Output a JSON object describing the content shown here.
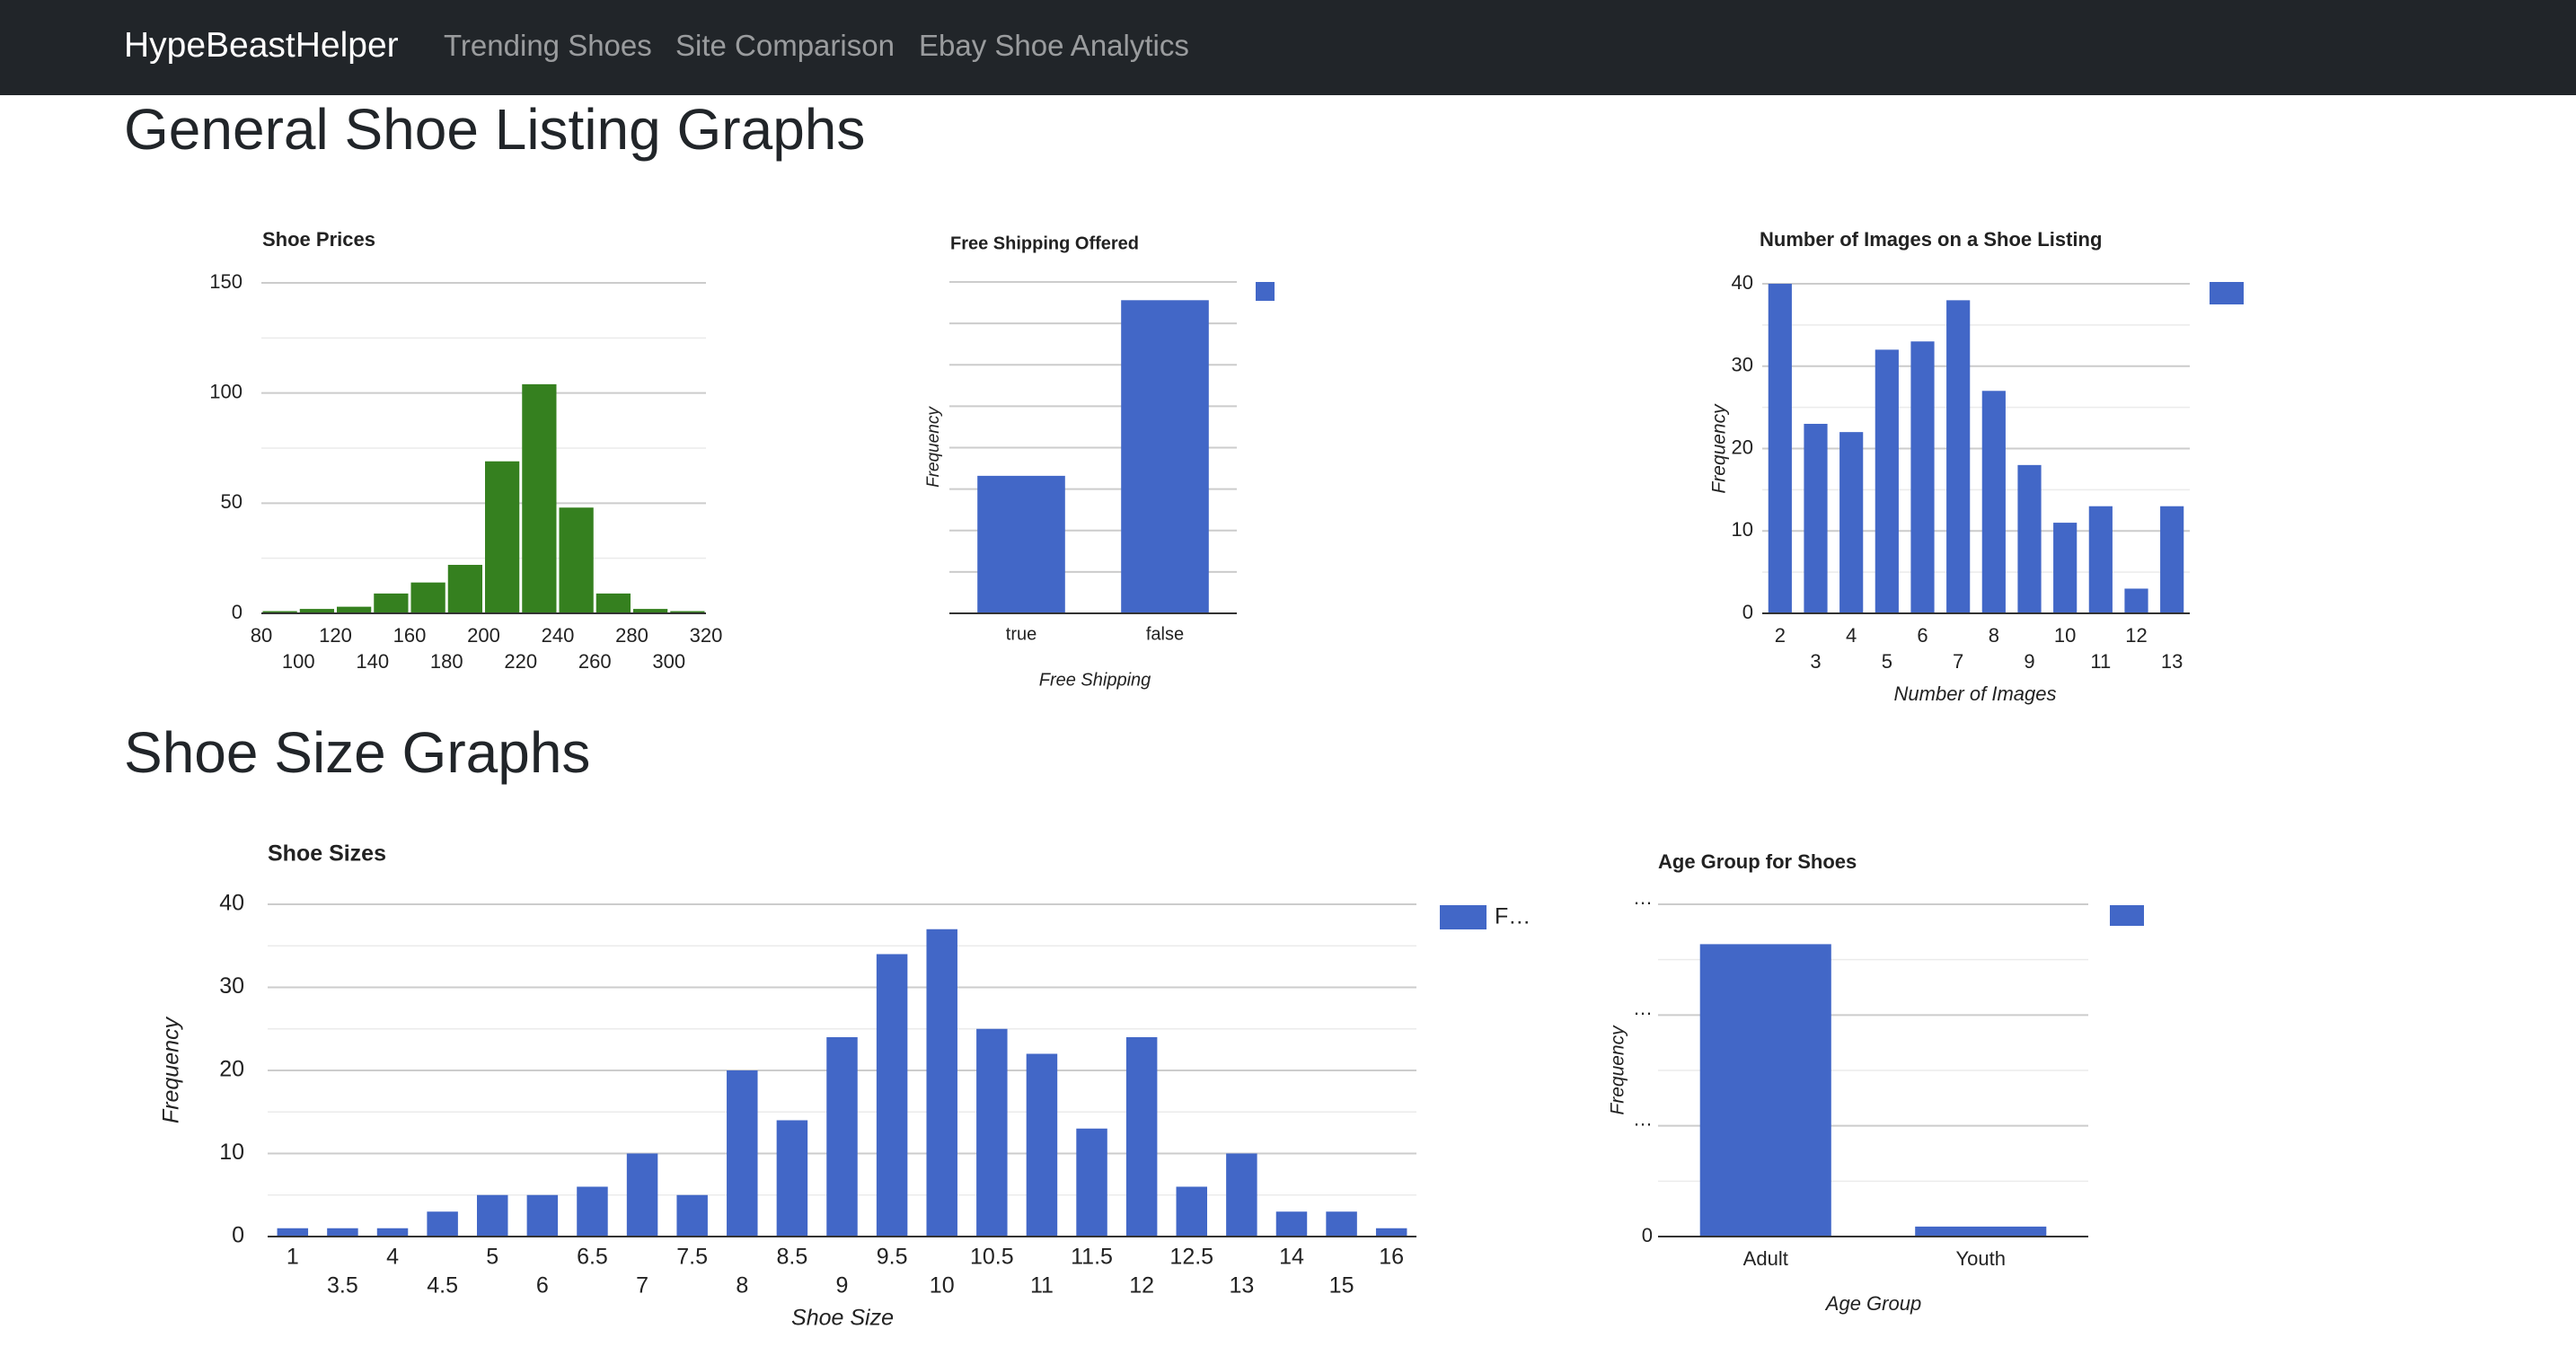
{
  "navbar": {
    "brand": "HypeBeastHelper",
    "links": [
      "Trending Shoes",
      "Site Comparison",
      "Ebay Shoe Analytics"
    ]
  },
  "sections": {
    "general_title": "General Shoe Listing Graphs",
    "size_title": "Shoe Size Graphs"
  },
  "colors": {
    "green": "#35801f",
    "blue": "#4267c7",
    "grid": "#cccccc",
    "minor_grid": "#ebebeb",
    "axis": "#333333"
  },
  "chart_data": [
    {
      "id": "prices",
      "type": "bar",
      "title": "Shoe Prices",
      "xlabel": "",
      "ylabel": "",
      "bin_edges": [
        80,
        100,
        120,
        140,
        160,
        180,
        200,
        220,
        240,
        260,
        280,
        300,
        320
      ],
      "values": [
        1,
        2,
        3,
        9,
        14,
        22,
        69,
        104,
        48,
        9,
        2,
        1
      ],
      "x_ticks_row1": [
        "80",
        "120",
        "160",
        "200",
        "240",
        "280",
        "320"
      ],
      "x_ticks_row2": [
        "100",
        "140",
        "180",
        "220",
        "260",
        "300"
      ],
      "y_ticks": [
        "0",
        "50",
        "100",
        "150"
      ],
      "ylim": [
        0,
        150
      ],
      "grid": true,
      "legend": "none"
    },
    {
      "id": "shipping",
      "type": "bar",
      "title": "Free Shipping Offered",
      "xlabel": "Free Shipping",
      "ylabel": "Frequency",
      "categories": [
        "true",
        "false"
      ],
      "values": [
        83,
        189
      ],
      "ylim": [
        0,
        200
      ],
      "grid": true,
      "legend": "top-right"
    },
    {
      "id": "images",
      "type": "bar",
      "title": "Number of Images on a Shoe Listing",
      "xlabel": "Number of Images",
      "ylabel": "Frequency",
      "categories": [
        "2",
        "3",
        "4",
        "5",
        "6",
        "7",
        "8",
        "9",
        "10",
        "11",
        "12",
        "13"
      ],
      "values": [
        40,
        23,
        22,
        32,
        33,
        38,
        27,
        18,
        11,
        13,
        3,
        13
      ],
      "y_ticks": [
        "0",
        "10",
        "20",
        "30",
        "40"
      ],
      "ylim": [
        0,
        40
      ],
      "grid": true,
      "legend": "top-right"
    },
    {
      "id": "sizes",
      "type": "bar",
      "title": "Shoe Sizes",
      "xlabel": "Shoe Size",
      "ylabel": "Frequency",
      "categories": [
        "1",
        "3.5",
        "4",
        "4.5",
        "5",
        "6",
        "6.5",
        "7",
        "7.5",
        "8",
        "8.5",
        "9",
        "9.5",
        "10",
        "10.5",
        "11",
        "11.5",
        "12",
        "12.5",
        "13",
        "14",
        "15",
        "16"
      ],
      "values": [
        1,
        1,
        1,
        3,
        5,
        5,
        6,
        10,
        5,
        20,
        14,
        24,
        34,
        37,
        25,
        22,
        13,
        24,
        6,
        10,
        3,
        3,
        1
      ],
      "y_ticks": [
        "0",
        "10",
        "20",
        "30",
        "40"
      ],
      "ylim": [
        0,
        40
      ],
      "grid": true,
      "legend": "top-right",
      "legend_label": "F…"
    },
    {
      "id": "age",
      "type": "bar",
      "title": "Age Group for Shoes",
      "xlabel": "Age Group",
      "ylabel": "Frequency",
      "categories": [
        "Adult",
        "Youth"
      ],
      "values": [
        264,
        9
      ],
      "y_ticks": [
        "0",
        "…",
        "…",
        "…"
      ],
      "ylim": [
        0,
        300
      ],
      "grid": true,
      "legend": "top-right"
    }
  ]
}
